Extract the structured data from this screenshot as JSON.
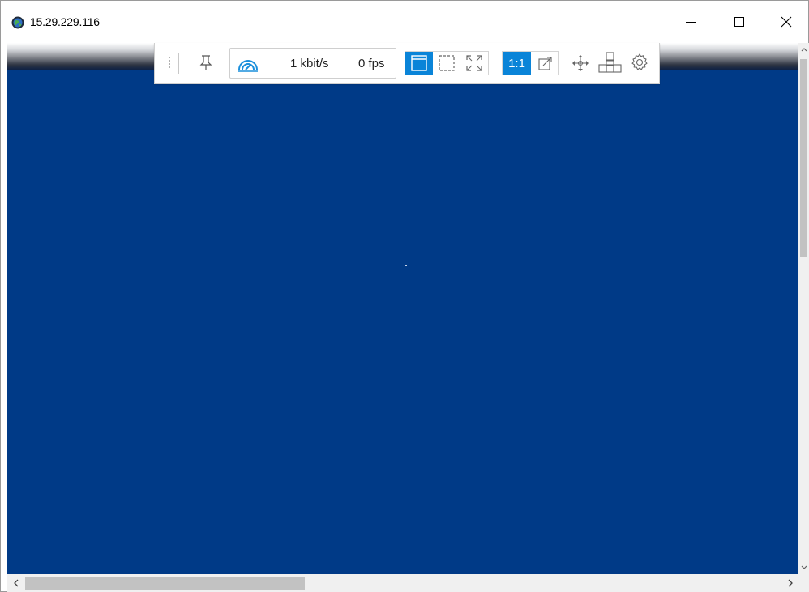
{
  "window": {
    "title": "15.29.229.116",
    "icon": "app-globe-icon",
    "controls": {
      "minimize": "minimize-icon",
      "maximize": "maximize-icon",
      "close": "close-icon"
    }
  },
  "remote": {
    "background_color": "#003a87"
  },
  "toolbar": {
    "bandwidth": "1 kbit/s",
    "fps": "0 fps",
    "scale_label": "1:1",
    "accent_color": "#0a84d8",
    "icons": {
      "grip": "grip-icon",
      "pin": "pin-icon",
      "gauge": "connection-quality-icon",
      "window_view": "window-view-icon",
      "selection_view": "selection-view-icon",
      "fullscreen": "fullscreen-icon",
      "scale_to_fit": "scale-to-fit-icon",
      "move": "move-icon",
      "monitors": "monitors-icon",
      "settings": "gear-icon"
    }
  }
}
